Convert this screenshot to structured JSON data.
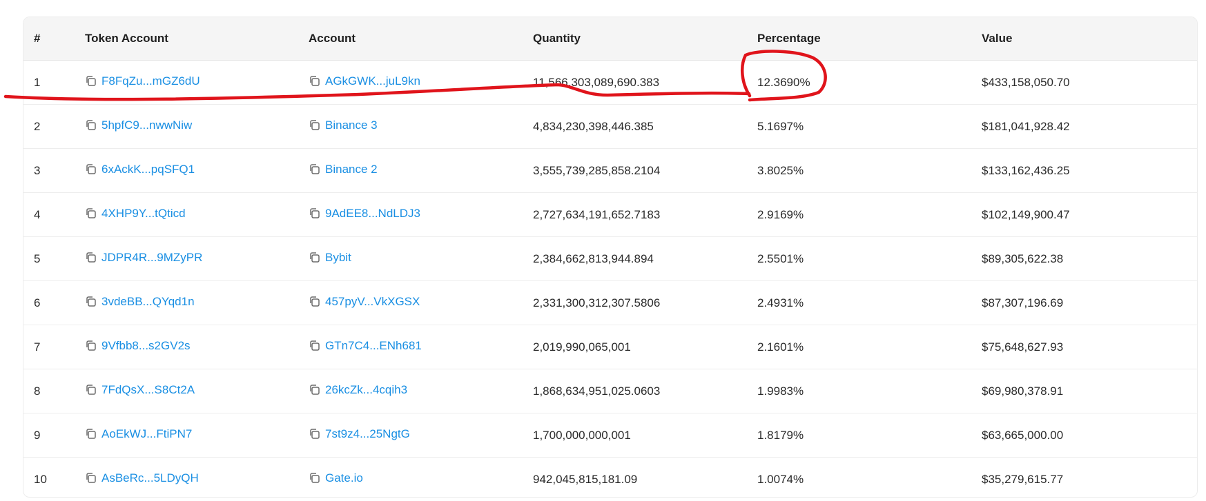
{
  "table": {
    "headers": [
      "#",
      "Token Account",
      "Account",
      "Quantity",
      "Percentage",
      "Value"
    ],
    "rows": [
      {
        "rank": "1",
        "token_account": "F8FqZu...mGZ6dU",
        "account": "AGkGWK...juL9kn",
        "quantity": "11,566,303,089,690.383",
        "percentage": "12.3690%",
        "value": "$433,158,050.70"
      },
      {
        "rank": "2",
        "token_account": "5hpfC9...nwwNiw",
        "account": "Binance 3",
        "quantity": "4,834,230,398,446.385",
        "percentage": "5.1697%",
        "value": "$181,041,928.42"
      },
      {
        "rank": "3",
        "token_account": "6xAckK...pqSFQ1",
        "account": "Binance 2",
        "quantity": "3,555,739,285,858.2104",
        "percentage": "3.8025%",
        "value": "$133,162,436.25"
      },
      {
        "rank": "4",
        "token_account": "4XHP9Y...tQticd",
        "account": "9AdEE8...NdLDJ3",
        "quantity": "2,727,634,191,652.7183",
        "percentage": "2.9169%",
        "value": "$102,149,900.47"
      },
      {
        "rank": "5",
        "token_account": "JDPR4R...9MZyPR",
        "account": "Bybit",
        "quantity": "2,384,662,813,944.894",
        "percentage": "2.5501%",
        "value": "$89,305,622.38"
      },
      {
        "rank": "6",
        "token_account": "3vdeBB...QYqd1n",
        "account": "457pyV...VkXGSX",
        "quantity": "2,331,300,312,307.5806",
        "percentage": "2.4931%",
        "value": "$87,307,196.69"
      },
      {
        "rank": "7",
        "token_account": "9Vfbb8...s2GV2s",
        "account": "GTn7C4...ENh681",
        "quantity": "2,019,990,065,001",
        "percentage": "2.1601%",
        "value": "$75,648,627.93"
      },
      {
        "rank": "8",
        "token_account": "7FdQsX...S8Ct2A",
        "account": "26kcZk...4cqih3",
        "quantity": "1,868,634,951,025.0603",
        "percentage": "1.9983%",
        "value": "$69,980,378.91"
      },
      {
        "rank": "9",
        "token_account": "AoEkWJ...FtiPN7",
        "account": "7st9z4...25NgtG",
        "quantity": "1,700,000,000,001",
        "percentage": "1.8179%",
        "value": "$63,665,000.00"
      },
      {
        "rank": "10",
        "token_account": "AsBeRc...5LDyQH",
        "account": "Gate.io",
        "quantity": "942,045,815,181.09",
        "percentage": "1.0074%",
        "value": "$35,279,615.77"
      }
    ]
  },
  "icons": {
    "copy": "copy-icon"
  },
  "colors": {
    "link": "#1a8fe3",
    "annotation": "#e0141b",
    "header_bg": "#f5f5f5"
  }
}
